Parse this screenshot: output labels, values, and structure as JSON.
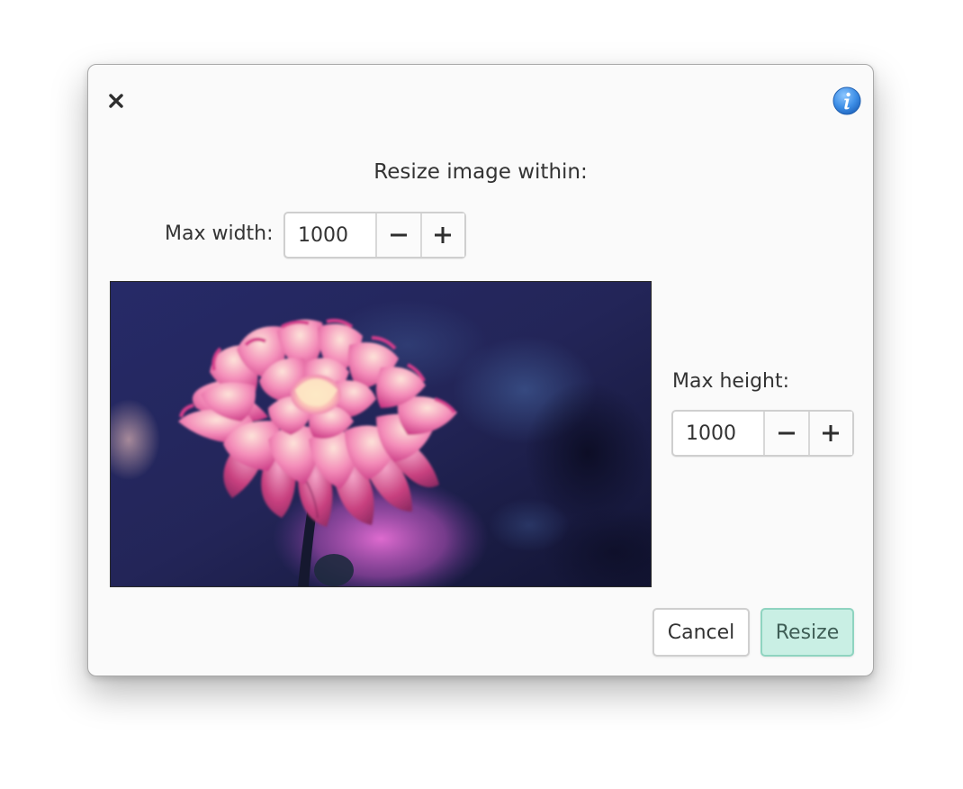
{
  "dialog": {
    "heading": "Resize image within:",
    "close_icon": "close-icon",
    "info_icon": "info-icon"
  },
  "width_field": {
    "label": "Max width:",
    "value": "1000",
    "decrement_icon": "minus-icon",
    "increment_icon": "plus-icon"
  },
  "height_field": {
    "label": "Max height:",
    "value": "1000",
    "decrement_icon": "minus-icon",
    "increment_icon": "plus-icon"
  },
  "preview": {
    "subject": "pink dahlia flower photo"
  },
  "actions": {
    "cancel_label": "Cancel",
    "resize_label": "Resize"
  },
  "colors": {
    "dialog_bg": "#fafafa",
    "accent_bg": "#c9efe4",
    "accent_border": "#8fd4c0",
    "info_blue": "#3d8ee6"
  }
}
